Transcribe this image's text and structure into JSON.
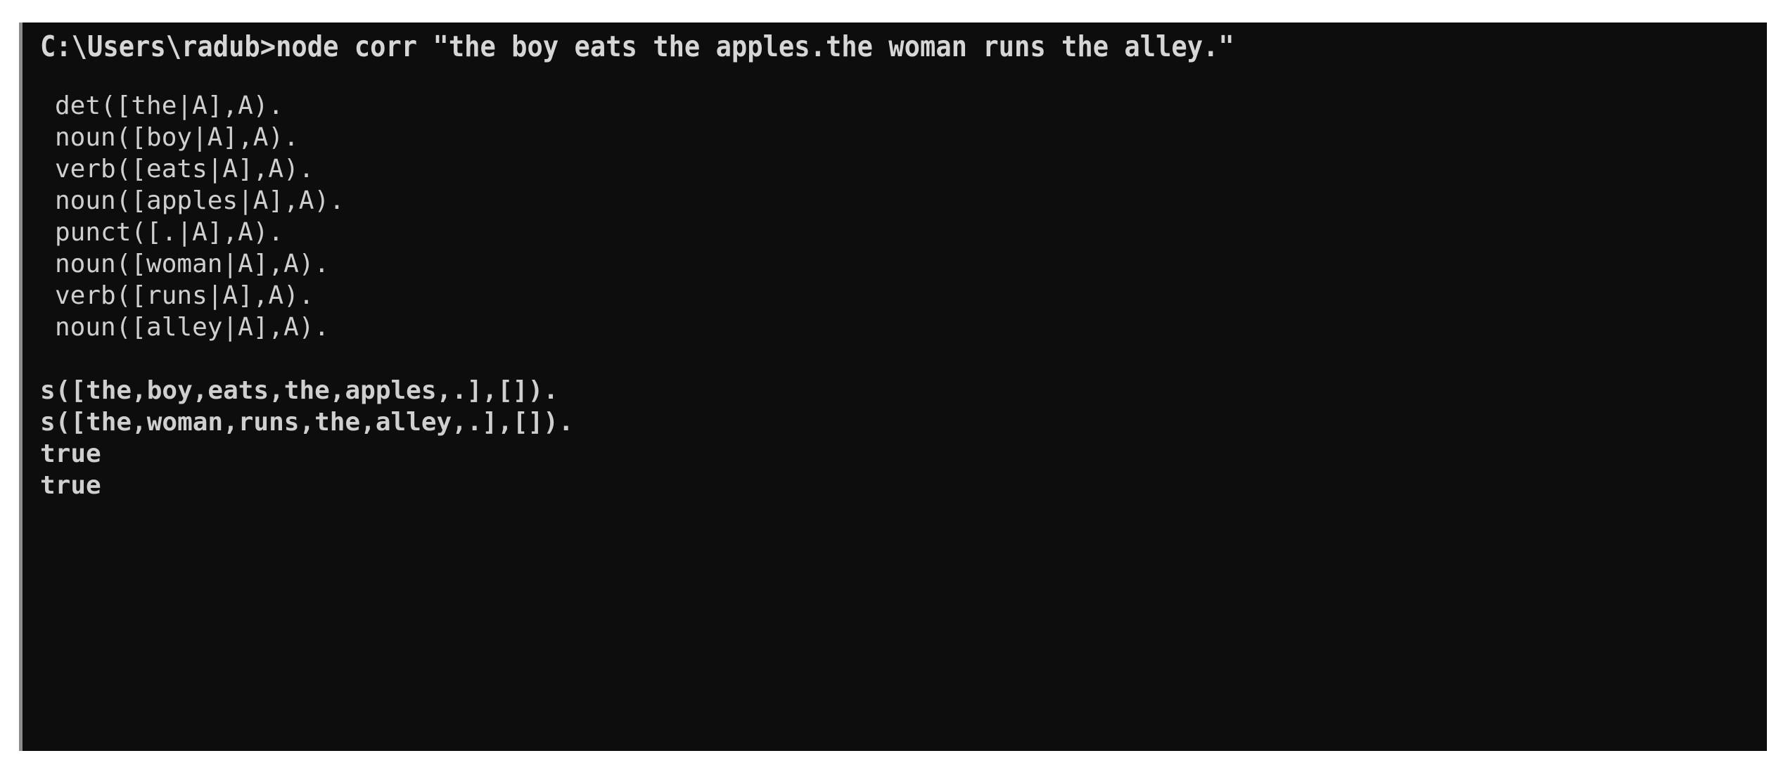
{
  "window": {
    "type": "windows-command-prompt",
    "background_color": "#0d0d0d",
    "text_color": "#cfcfcf",
    "border_color": "#8c8c8c",
    "page_background": "#ffffff"
  },
  "prompt": {
    "path": "C:\\Users\\radub",
    "separator": ">",
    "command": "node corr \"the boy eats the apples.the woman runs the alley.\"",
    "full_line": "C:\\Users\\radub>node corr \"the boy eats the apples.the woman runs the alley.\""
  },
  "output": {
    "clause_block": [
      "det([the|A],A).",
      "noun([boy|A],A).",
      "verb([eats|A],A).",
      "noun([apples|A],A).",
      "punct([.|A],A).",
      "noun([woman|A],A).",
      "verb([runs|A],A).",
      "noun([alley|A],A)."
    ],
    "result_block": [
      "s([the,boy,eats,the,apples,.],[]).",
      "s([the,woman,runs,the,alley,.],[]).",
      "true",
      "true"
    ]
  }
}
